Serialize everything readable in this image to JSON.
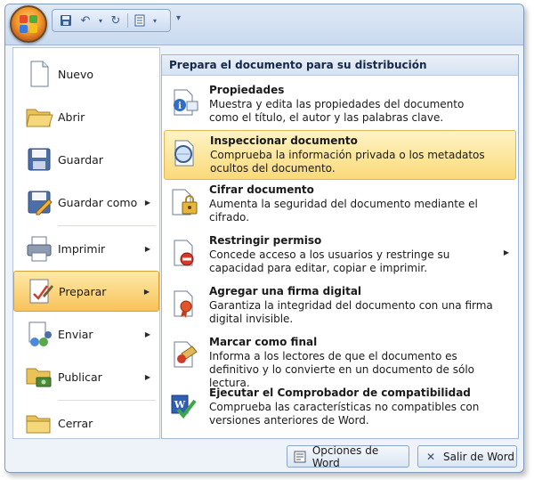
{
  "quick_access": {
    "items": [
      "save-icon",
      "undo-icon",
      "redo-icon",
      "print-preview-icon"
    ],
    "more_label": "▾"
  },
  "left_menu": {
    "items": [
      {
        "label": "Nuevo",
        "underline": "N",
        "has_submenu": false,
        "icon": "new-document-icon"
      },
      {
        "label": "Abrir",
        "underline": "A",
        "has_submenu": false,
        "icon": "open-folder-icon"
      },
      {
        "label": "Guardar",
        "underline": "G",
        "has_submenu": false,
        "icon": "save-disk-icon"
      },
      {
        "label": "Guardar como",
        "underline": "u",
        "has_submenu": true,
        "icon": "save-as-icon"
      },
      {
        "label": "Imprimir",
        "underline": "I",
        "has_submenu": true,
        "icon": "printer-icon"
      },
      {
        "label": "Preparar",
        "underline": "P",
        "has_submenu": true,
        "icon": "prepare-icon",
        "active": true
      },
      {
        "label": "Enviar",
        "underline": "E",
        "has_submenu": true,
        "icon": "send-icon"
      },
      {
        "label": "Publicar",
        "underline": "b",
        "has_submenu": true,
        "icon": "publish-icon"
      },
      {
        "label": "Cerrar",
        "underline": "C",
        "has_submenu": false,
        "icon": "close-folder-icon"
      }
    ]
  },
  "panel": {
    "header": "Prepara el documento para su distribución",
    "items": [
      {
        "title": "Propiedades",
        "desc": "Muestra y edita las propiedades del documento como el título, el autor y las palabras clave.",
        "icon": "properties-icon"
      },
      {
        "title": "Inspeccionar documento",
        "desc": "Comprueba la información privada o los metadatos ocultos del documento.",
        "icon": "inspect-icon",
        "active": true
      },
      {
        "title": "Cifrar documento",
        "desc": "Aumenta la seguridad del documento mediante el cifrado.",
        "icon": "encrypt-icon"
      },
      {
        "title": "Restringir permiso",
        "desc": "Concede acceso a los usuarios y restringe su capacidad para editar, copiar e imprimir.",
        "icon": "restrict-icon",
        "has_submenu": true
      },
      {
        "title": "Agregar una firma digital",
        "desc": "Garantiza la integridad del documento con una firma digital invisible.",
        "icon": "signature-icon"
      },
      {
        "title": "Marcar como final",
        "desc": "Informa a los lectores de que el documento es definitivo y lo convierte en un documento de sólo lectura.",
        "icon": "mark-final-icon"
      },
      {
        "title": "Ejecutar el Comprobador de compatibilidad",
        "desc": "Comprueba las características no compatibles con versiones anteriores de Word.",
        "icon": "compatibility-icon"
      }
    ]
  },
  "footer": {
    "options_label": "Opciones de Word",
    "exit_label": "Salir de Word"
  }
}
